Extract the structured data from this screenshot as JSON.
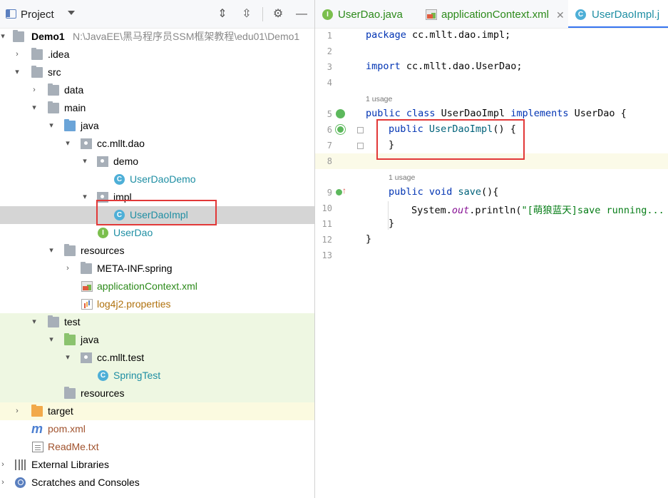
{
  "project_panel": {
    "title": "Project",
    "tree": [
      {
        "label": "Demo1",
        "path": "N:\\JavaEE\\黑马程序员SSM框架教程\\edu01\\Demo1"
      },
      {
        "label": ".idea"
      },
      {
        "label": "src"
      },
      {
        "label": "data"
      },
      {
        "label": "main"
      },
      {
        "label": "java"
      },
      {
        "label": "cc.mllt.dao"
      },
      {
        "label": "demo"
      },
      {
        "label": "UserDaoDemo"
      },
      {
        "label": "impl"
      },
      {
        "label": "UserDaoImpl"
      },
      {
        "label": "UserDao"
      },
      {
        "label": "resources"
      },
      {
        "label": "META-INF.spring"
      },
      {
        "label": "applicationContext.xml"
      },
      {
        "label": "log4j2.properties"
      },
      {
        "label": "test"
      },
      {
        "label": "java"
      },
      {
        "label": "cc.mllt.test"
      },
      {
        "label": "SpringTest"
      },
      {
        "label": "resources"
      },
      {
        "label": "target"
      },
      {
        "label": "pom.xml"
      },
      {
        "label": "ReadMe.txt"
      },
      {
        "label": "External Libraries"
      },
      {
        "label": "Scratches and Consoles"
      }
    ]
  },
  "editor": {
    "tabs": [
      {
        "label": "UserDao.java",
        "icon": "interface-icon"
      },
      {
        "label": "applicationContext.xml",
        "icon": "xml-icon"
      },
      {
        "label": "UserDaoImpl.j",
        "icon": "class-icon"
      }
    ],
    "usage_1": "1 usage",
    "usage_2": "1 usage",
    "line_numbers": [
      "1",
      "2",
      "3",
      "4",
      "5",
      "6",
      "7",
      "8",
      "9",
      "10",
      "11",
      "12",
      "13"
    ],
    "lines": {
      "l1_kw": "package",
      "l1_rest": " cc.mllt.dao.impl;",
      "l3_kw": "import",
      "l3_rest": " cc.mllt.dao.UserDao;",
      "l5_kw1": "public class",
      "l5_name": " UserDaoImpl ",
      "l5_kw2": "implements",
      "l5_rest": " UserDao {",
      "l6_kw": "public",
      "l6_fn": " UserDaoImpl",
      "l6_rest": "() {",
      "l7": "}",
      "l9_kw": "public void",
      "l9_fn": " save",
      "l9_rest": "(){",
      "l10_a": "System.",
      "l10_fld": "out",
      "l10_b": ".println(",
      "l10_str": "\"[萌狼蓝天]save running...",
      "l11": "}",
      "l12": "}"
    }
  },
  "colors": {
    "accent": "#3574f0",
    "highlight_box": "#e23838",
    "selected_row": "#d5d5d5"
  }
}
